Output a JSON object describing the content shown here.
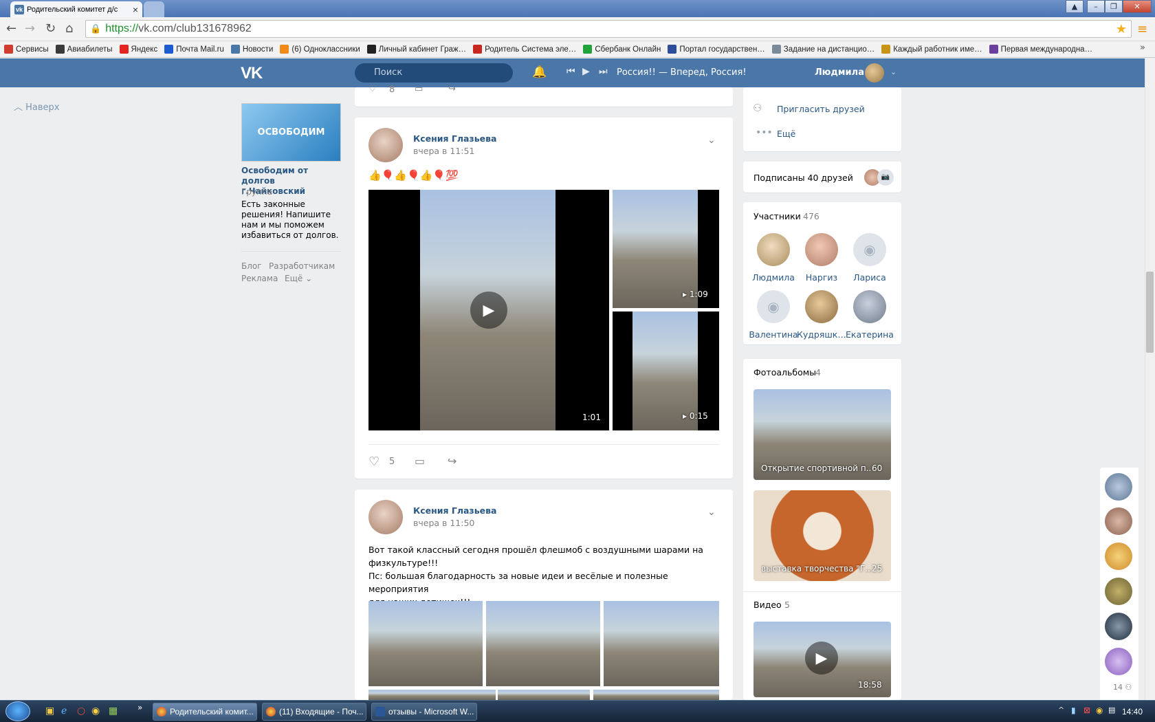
{
  "browser": {
    "tab_title": "Родительский комитет д/с",
    "tab_close": "×",
    "url_scheme": "https://",
    "url_rest": "vk.com/club131678962",
    "bookmarks": [
      {
        "label": "Сервисы",
        "color": "#d23c2e"
      },
      {
        "label": "Авиабилеты",
        "color": "#3a3a3a"
      },
      {
        "label": "Яндекс",
        "color": "#e52620"
      },
      {
        "label": "Почта Mail.ru",
        "color": "#1d5bd1"
      },
      {
        "label": "Новости",
        "color": "#4a76a8"
      },
      {
        "label": "(6) Одноклассники",
        "color": "#f28a1a"
      },
      {
        "label": "Личный кабинет Граж…",
        "color": "#222222"
      },
      {
        "label": "Родитель Система эле…",
        "color": "#c8281f"
      },
      {
        "label": "Сбербанк Онлайн",
        "color": "#20a33b"
      },
      {
        "label": "Портал государствен…",
        "color": "#2e4e9c"
      },
      {
        "label": "Задание на дистанцио…",
        "color": "#7a8a9a"
      },
      {
        "label": "Каждый работник име…",
        "color": "#c89418"
      },
      {
        "label": "Первая международна…",
        "color": "#6b3fa0"
      }
    ]
  },
  "vk": {
    "logo": "VK",
    "search_placeholder": "Поиск",
    "now_playing": "Россия!! — Вперед, Россия!",
    "user_name": "Людмила"
  },
  "left": {
    "back_to_top": "Наверх",
    "ad": {
      "image_text": "ОСВОБОДИМ",
      "title": "Освободим от долгов г.Чайковский",
      "subtitle": "Группа",
      "text": "Есть законные решения! Напишите нам и мы поможем избавиться от долгов."
    },
    "footer": {
      "blog": "Блог",
      "dev": "Разработчикам",
      "ads": "Реклама",
      "more": "Ещё"
    }
  },
  "feed": {
    "prev_post_likes": "8",
    "post1": {
      "author": "Ксения Глазьева",
      "time": "вчера в 11:51",
      "emoji": "👍🎈👍🎈👍🎈💯",
      "videos": [
        {
          "duration": "1:01"
        },
        {
          "duration": "1:09"
        },
        {
          "duration": "0:15"
        }
      ],
      "likes": "5"
    },
    "post2": {
      "author": "Ксения Глазьева",
      "time": "вчера в 11:50",
      "text_line1": "Вот такой классный сегодня прошёл флешмоб с воздушными шарами на",
      "text_line2": "физкультуре!!!",
      "text_line3": "Пс: большая благодарность за новые идеи и весёлые и полезные мероприятия",
      "text_line4": "для наших детишек!!!"
    }
  },
  "right": {
    "invite": "Пригласить друзей",
    "more": "Ещё",
    "friends_subscribed": "Подписаны 40 друзей",
    "members_title": "Участники",
    "members_count": "476",
    "members": [
      {
        "name": "Людмила"
      },
      {
        "name": "Наргиз"
      },
      {
        "name": "Лариса"
      },
      {
        "name": "Валентина"
      },
      {
        "name": "Кудряшка..."
      },
      {
        "name": "Екатерина"
      }
    ],
    "albums_title": "Фотоальбомы",
    "albums_count": "4",
    "albums": [
      {
        "title": "Открытие спортивной п...",
        "count": "60"
      },
      {
        "title": "выставка творчества \"Г...",
        "count": "25"
      }
    ],
    "video_title": "Видео",
    "video_count": "5",
    "video_duration": "18:58",
    "online_count": "14"
  },
  "taskbar": {
    "items": [
      {
        "label": "Родительский комит...",
        "active": true
      },
      {
        "label": "(11) Входящие - Поч...",
        "active": false
      },
      {
        "label": "отзывы - Microsoft W...",
        "active": false
      }
    ],
    "clock": "14:40"
  }
}
